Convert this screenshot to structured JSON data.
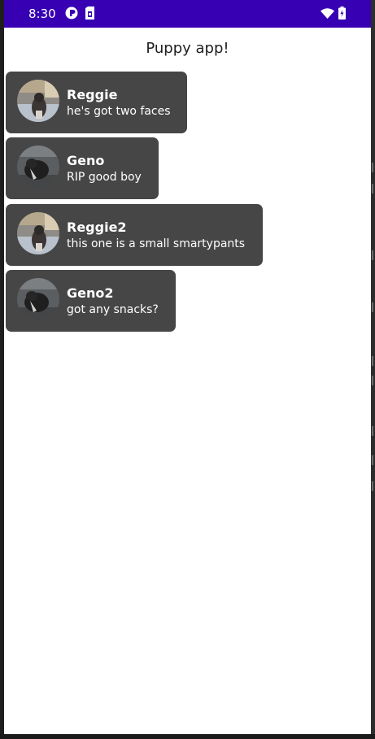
{
  "status_bar": {
    "time": "8:30",
    "icons": [
      "circle-status-icon",
      "sim-icon",
      "wifi-icon",
      "battery-icon"
    ],
    "background_color": "#3700b3"
  },
  "app": {
    "title": "Puppy app!"
  },
  "messages": [
    {
      "name": "Reggie",
      "text": "he's got two faces",
      "avatar": "reggie-avatar"
    },
    {
      "name": "Geno",
      "text": "RIP good boy",
      "avatar": "geno-avatar"
    },
    {
      "name": "Reggie2",
      "text": "this one is a small smartypants",
      "avatar": "reggie-avatar"
    },
    {
      "name": "Geno2",
      "text": "got any snacks?",
      "avatar": "geno-avatar"
    }
  ],
  "colors": {
    "card_background": "#464646",
    "card_text": "#ffffff",
    "page_background": "#ffffff"
  }
}
